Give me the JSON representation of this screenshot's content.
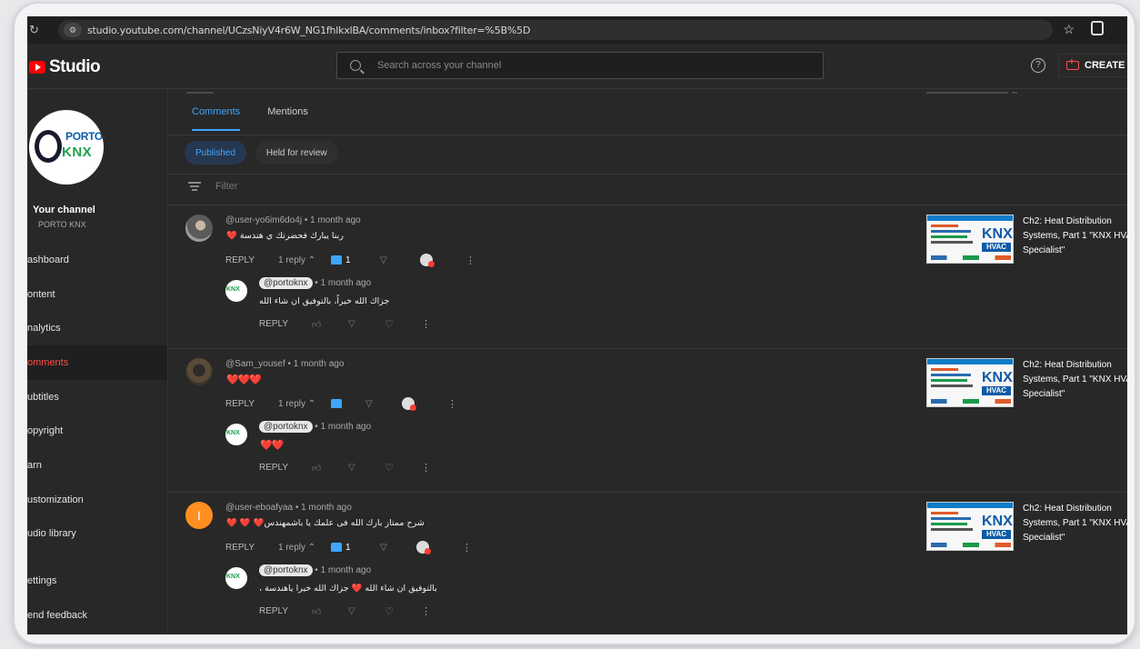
{
  "browser": {
    "url": "studio.youtube.com/channel/UCzsNiyV4r6W_NG1fhlkxlBA/comments/inbox?filter=%5B%5D"
  },
  "header": {
    "logo_text": "Studio",
    "search_placeholder": "Search across your channel",
    "help": "?",
    "create_label": "CREATE"
  },
  "sidebar": {
    "avatar_porto": "PORTO",
    "avatar_knx": "KNX",
    "your_channel": "Your channel",
    "channel_name": "PORTO KNX",
    "items": [
      {
        "label": "ashboard"
      },
      {
        "label": "ontent"
      },
      {
        "label": "nalytics"
      },
      {
        "label": "omments"
      },
      {
        "label": "ubtitles"
      },
      {
        "label": "opyright"
      },
      {
        "label": "arn"
      },
      {
        "label": "ustomization"
      },
      {
        "label": "udio library"
      },
      {
        "label": "ettings"
      },
      {
        "label": "end feedback"
      }
    ]
  },
  "main": {
    "tabs": [
      {
        "label": "Comments"
      },
      {
        "label": "Mentions"
      }
    ],
    "chips": [
      {
        "label": "Published"
      },
      {
        "label": "Held for review"
      }
    ],
    "filter_label": "Filter",
    "reply_label": "REPLY",
    "threads": [
      {
        "author": "@user-yo6im6do4j",
        "time": "• 1 month ago",
        "text": "❤️ ربنا يبارك فحضرتك ي هندسة",
        "replies_label": "1 reply",
        "likes": "1",
        "reply": {
          "author": "@portoknx",
          "time": "• 1 month ago",
          "text": "جزاك الله خيراً، بالتوفيق ان شاء الله"
        },
        "video": {
          "knx": "KNX",
          "hvac": "HVAC",
          "title": "Ch2: Heat Distribution Systems, Part 1 \"KNX HVAC Specialist\""
        }
      },
      {
        "author": "@Sam_yousef",
        "time": "• 1 month ago",
        "text": "❤️❤️❤️",
        "replies_label": "1 reply",
        "likes": "",
        "reply": {
          "author": "@portoknx",
          "time": "• 1 month ago",
          "text": "❤️❤️"
        },
        "video": {
          "knx": "KNX",
          "hvac": "HVAC",
          "title": "Ch2: Heat Distribution Systems, Part 1 \"KNX HVAC Specialist\""
        }
      },
      {
        "author": "@user-eboafyaa",
        "avatar_letter": "I",
        "time": "• 1 month ago",
        "text": "❤️ ❤️ ❤️شرح ممتاز بارك الله فى علمك يا باشمهندس",
        "replies_label": "1 reply",
        "likes": "1",
        "reply": {
          "author": "@portoknx",
          "time": "• 1 month ago",
          "text": "، بالتوفيق ان شاء الله ❤️ جزاك الله خيرا ياهندسة"
        },
        "video": {
          "knx": "KNX",
          "hvac": "HVAC",
          "title": "Ch2: Heat Distribution Systems, Part 1 \"KNX HVAC Specialist\""
        }
      }
    ]
  },
  "colors": {
    "accent_blue": "#3ea6ff",
    "youtube_red": "#ff0000",
    "background": "#282828"
  }
}
